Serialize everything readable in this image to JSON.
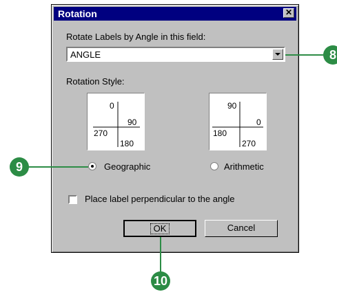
{
  "window": {
    "title": "Rotation",
    "close_glyph": "✕"
  },
  "field_label": "Rotate Labels by Angle in this field:",
  "field": {
    "value": "ANGLE"
  },
  "style_label": "Rotation Style:",
  "diagrams": {
    "geographic": {
      "top": "0",
      "right": "90",
      "bottom": "180",
      "left": "270"
    },
    "arithmetic": {
      "top": "90",
      "right": "0",
      "bottom": "270",
      "left": "180"
    }
  },
  "options": {
    "geographic": {
      "label": "Geographic",
      "selected": true
    },
    "arithmetic": {
      "label": "Arithmetic",
      "selected": false
    }
  },
  "perpendicular": {
    "label": "Place label perpendicular to the angle",
    "checked": false
  },
  "buttons": {
    "ok": "OK",
    "cancel": "Cancel"
  },
  "callouts": {
    "c8": "8",
    "c9": "9",
    "c10": "10"
  },
  "callout_color": "#2c8c45"
}
